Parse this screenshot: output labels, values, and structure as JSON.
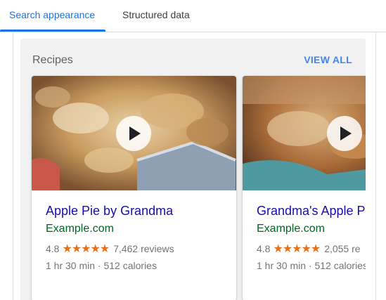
{
  "tabs": [
    {
      "label": "Search appearance",
      "active": true
    },
    {
      "label": "Structured data",
      "active": false
    }
  ],
  "panel": {
    "title": "Recipes",
    "view_all": "VIEW ALL"
  },
  "cards": [
    {
      "title": "Apple Pie by Grandma",
      "site": "Example.com",
      "rating": "4.8",
      "stars": "★★★★★",
      "reviews": "7,462 reviews",
      "meta": "1 hr 30 min · 512 calories",
      "thumbnail_icon": "play-icon"
    },
    {
      "title": "Grandma's Apple P",
      "site": "Example.com",
      "rating": "4.8",
      "stars": "★★★★★",
      "reviews": "2,055 re",
      "meta": "1 hr 30 min · 512 calories",
      "thumbnail_icon": "play-icon"
    }
  ],
  "colors": {
    "accent": "#1a73e8",
    "title_link": "#1a0dab",
    "site_green": "#006621",
    "star_orange": "#e7711b",
    "view_all": "#4285f4"
  }
}
